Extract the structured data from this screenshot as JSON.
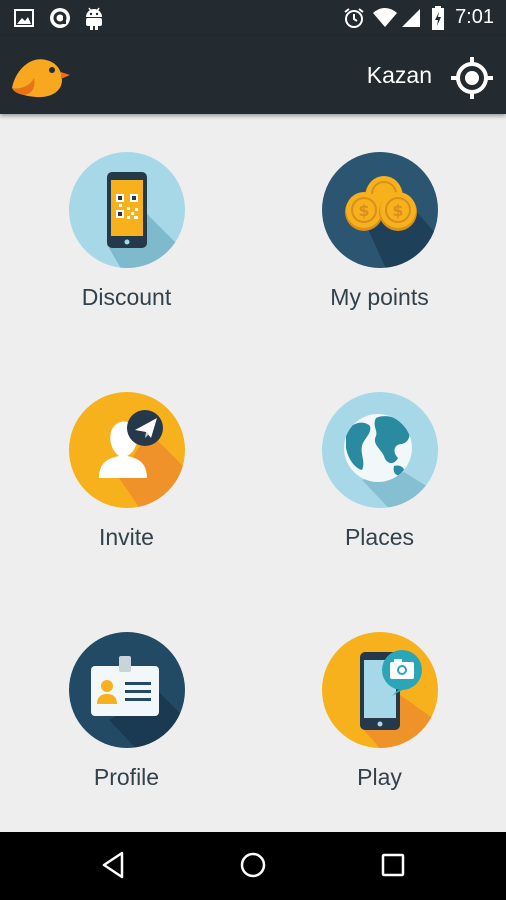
{
  "status_bar": {
    "time": "7:01",
    "left_icons": [
      "image-icon",
      "app-icon",
      "android-icon"
    ],
    "right_icons": [
      "alarm-icon",
      "wifi-icon",
      "signal-icon",
      "battery-icon"
    ]
  },
  "app_bar": {
    "city": "Kazan",
    "logo_icon": "bird-logo-icon",
    "locate_icon": "crosshair-icon"
  },
  "menu": [
    {
      "label": "Discount",
      "icon": "phone-qr-icon",
      "color": "#a6d8e7"
    },
    {
      "label": "My points",
      "icon": "coins-icon",
      "color": "#2c5572"
    },
    {
      "label": "Invite",
      "icon": "person-send-icon",
      "color": "#f7b11d"
    },
    {
      "label": "Places",
      "icon": "globe-icon",
      "color": "#a6d8e7"
    },
    {
      "label": "Profile",
      "icon": "id-card-icon",
      "color": "#234a65"
    },
    {
      "label": "Play",
      "icon": "phone-camera-icon",
      "color": "#f7b11d"
    }
  ],
  "nav_bar": {
    "back_icon": "back-triangle-icon",
    "home_icon": "home-circle-icon",
    "recents_icon": "recents-square-icon"
  },
  "colors": {
    "bar": "#232a30",
    "background": "#eeeeee",
    "label": "#33414b",
    "accent": "#f7b11d"
  }
}
